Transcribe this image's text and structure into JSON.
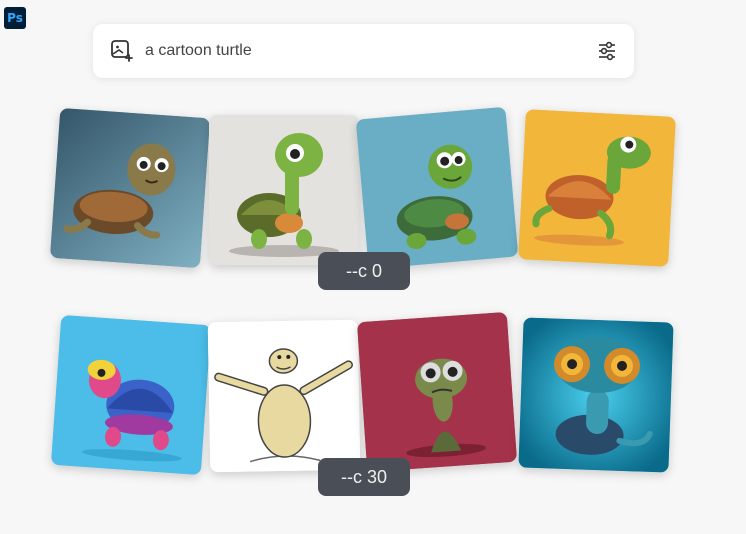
{
  "app": {
    "badge": "Ps"
  },
  "prompt": {
    "text": "a cartoon turtle"
  },
  "rows": [
    {
      "tag": "--c 0"
    },
    {
      "tag": "--c 30"
    }
  ],
  "images": [
    {
      "name": "turtle-realistic-blue",
      "bg": "#5a8aa0"
    },
    {
      "name": "turtle-green-long-neck",
      "bg": "#e4e2df"
    },
    {
      "name": "turtle-teal-bg",
      "bg": "#6aaec6"
    },
    {
      "name": "turtle-yellow-bg",
      "bg": "#f2b63a"
    },
    {
      "name": "turtle-colorful-cyan",
      "bg": "#4bbde8"
    },
    {
      "name": "turtle-sketch-waving",
      "bg": "#ffffff"
    },
    {
      "name": "turtle-zombie-red",
      "bg": "#a5324b"
    },
    {
      "name": "turtle-goggles-steampunk",
      "bg": "#1a9bc0"
    }
  ]
}
